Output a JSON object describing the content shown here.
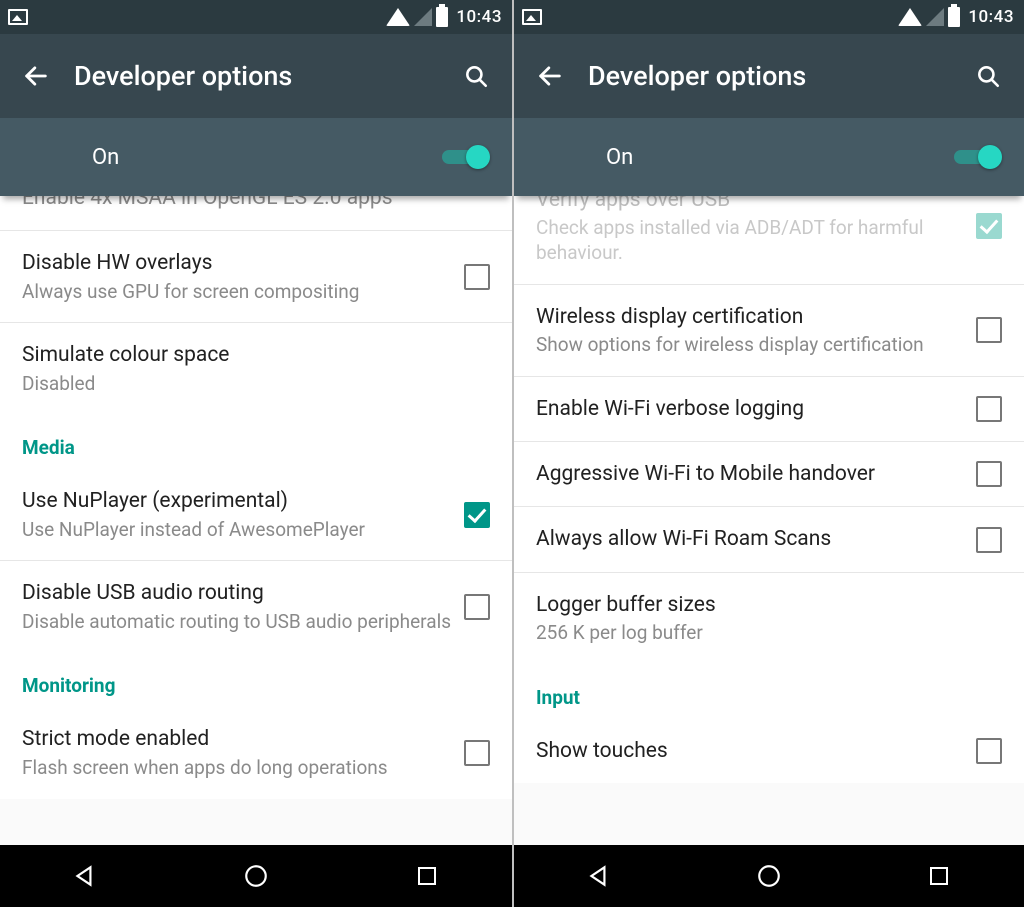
{
  "status": {
    "time": "10:43"
  },
  "appbar": {
    "title": "Developer options"
  },
  "master": {
    "label": "On"
  },
  "colors": {
    "teal": "#009688",
    "tealLight": "#26d7c3",
    "appbar": "#37474f",
    "masterBar": "#455a64"
  },
  "leftPane": {
    "cutTop": "Enable 4x MSAA in OpenGL ES 2.0 apps",
    "items": [
      {
        "title": "Disable HW overlays",
        "sub": "Always use GPU for screen compositing",
        "checkbox": true,
        "checked": false
      },
      {
        "title": "Simulate colour space",
        "sub": "Disabled",
        "checkbox": false
      }
    ],
    "headerMedia": "Media",
    "mediaItems": [
      {
        "title": "Use NuPlayer (experimental)",
        "sub": "Use NuPlayer instead of AwesomePlayer",
        "checkbox": true,
        "checked": true
      },
      {
        "title": "Disable USB audio routing",
        "sub": "Disable automatic routing to USB audio peripherals",
        "checkbox": true,
        "checked": false
      }
    ],
    "headerMonitoring": "Monitoring",
    "monitoringItems": [
      {
        "title": "Strict mode enabled",
        "sub": "Flash screen when apps do long operations",
        "checkbox": true,
        "checked": false
      }
    ]
  },
  "rightPane": {
    "cutTopTitle": "Verify apps over USB",
    "cutTopSub": "Check apps installed via ADB/ADT for harmful behaviour.",
    "items": [
      {
        "title": "Wireless display certification",
        "sub": "Show options for wireless display certification",
        "checkbox": true,
        "checked": false
      },
      {
        "title": "Enable Wi‑Fi verbose logging",
        "checkbox": true,
        "checked": false
      },
      {
        "title": "Aggressive Wi‑Fi to Mobile handover",
        "checkbox": true,
        "checked": false
      },
      {
        "title": "Always allow Wi‑Fi Roam Scans",
        "checkbox": true,
        "checked": false
      },
      {
        "title": "Logger buffer sizes",
        "sub": "256 K per log buffer",
        "checkbox": false
      }
    ],
    "headerInput": "Input",
    "inputItems": [
      {
        "title": "Show touches",
        "checkbox": true,
        "checked": false
      }
    ]
  }
}
